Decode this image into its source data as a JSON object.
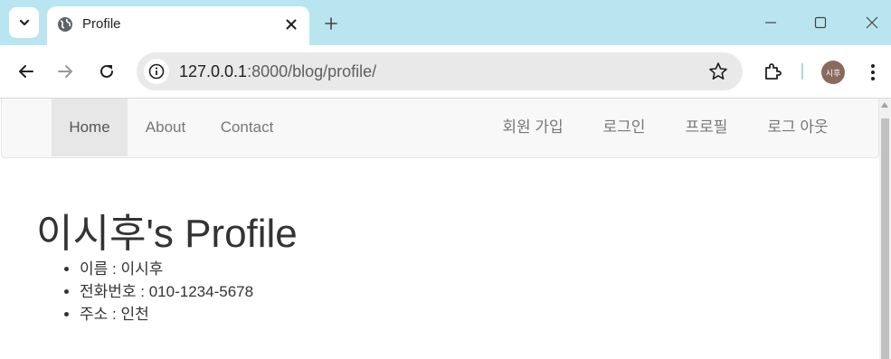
{
  "browser": {
    "tab": {
      "title": "Profile",
      "favicon": "globe-icon"
    },
    "address": {
      "host": "127.0.0.1",
      "rest": ":8000/blog/profile/"
    },
    "profile_avatar": "시후",
    "colors": {
      "tabstrip": "#b9e5f1",
      "avatar": "#8a6a5c"
    }
  },
  "navbar": {
    "left": [
      "Home",
      "About",
      "Contact"
    ],
    "right": [
      "회원 가입",
      "로그인",
      "프로필",
      "로그 아웃"
    ],
    "active": "Home"
  },
  "page": {
    "title": "이시후's Profile",
    "info": [
      "이름 : 이시후",
      "전화번호 : 010-1234-5678",
      "주소 : 인천"
    ]
  }
}
